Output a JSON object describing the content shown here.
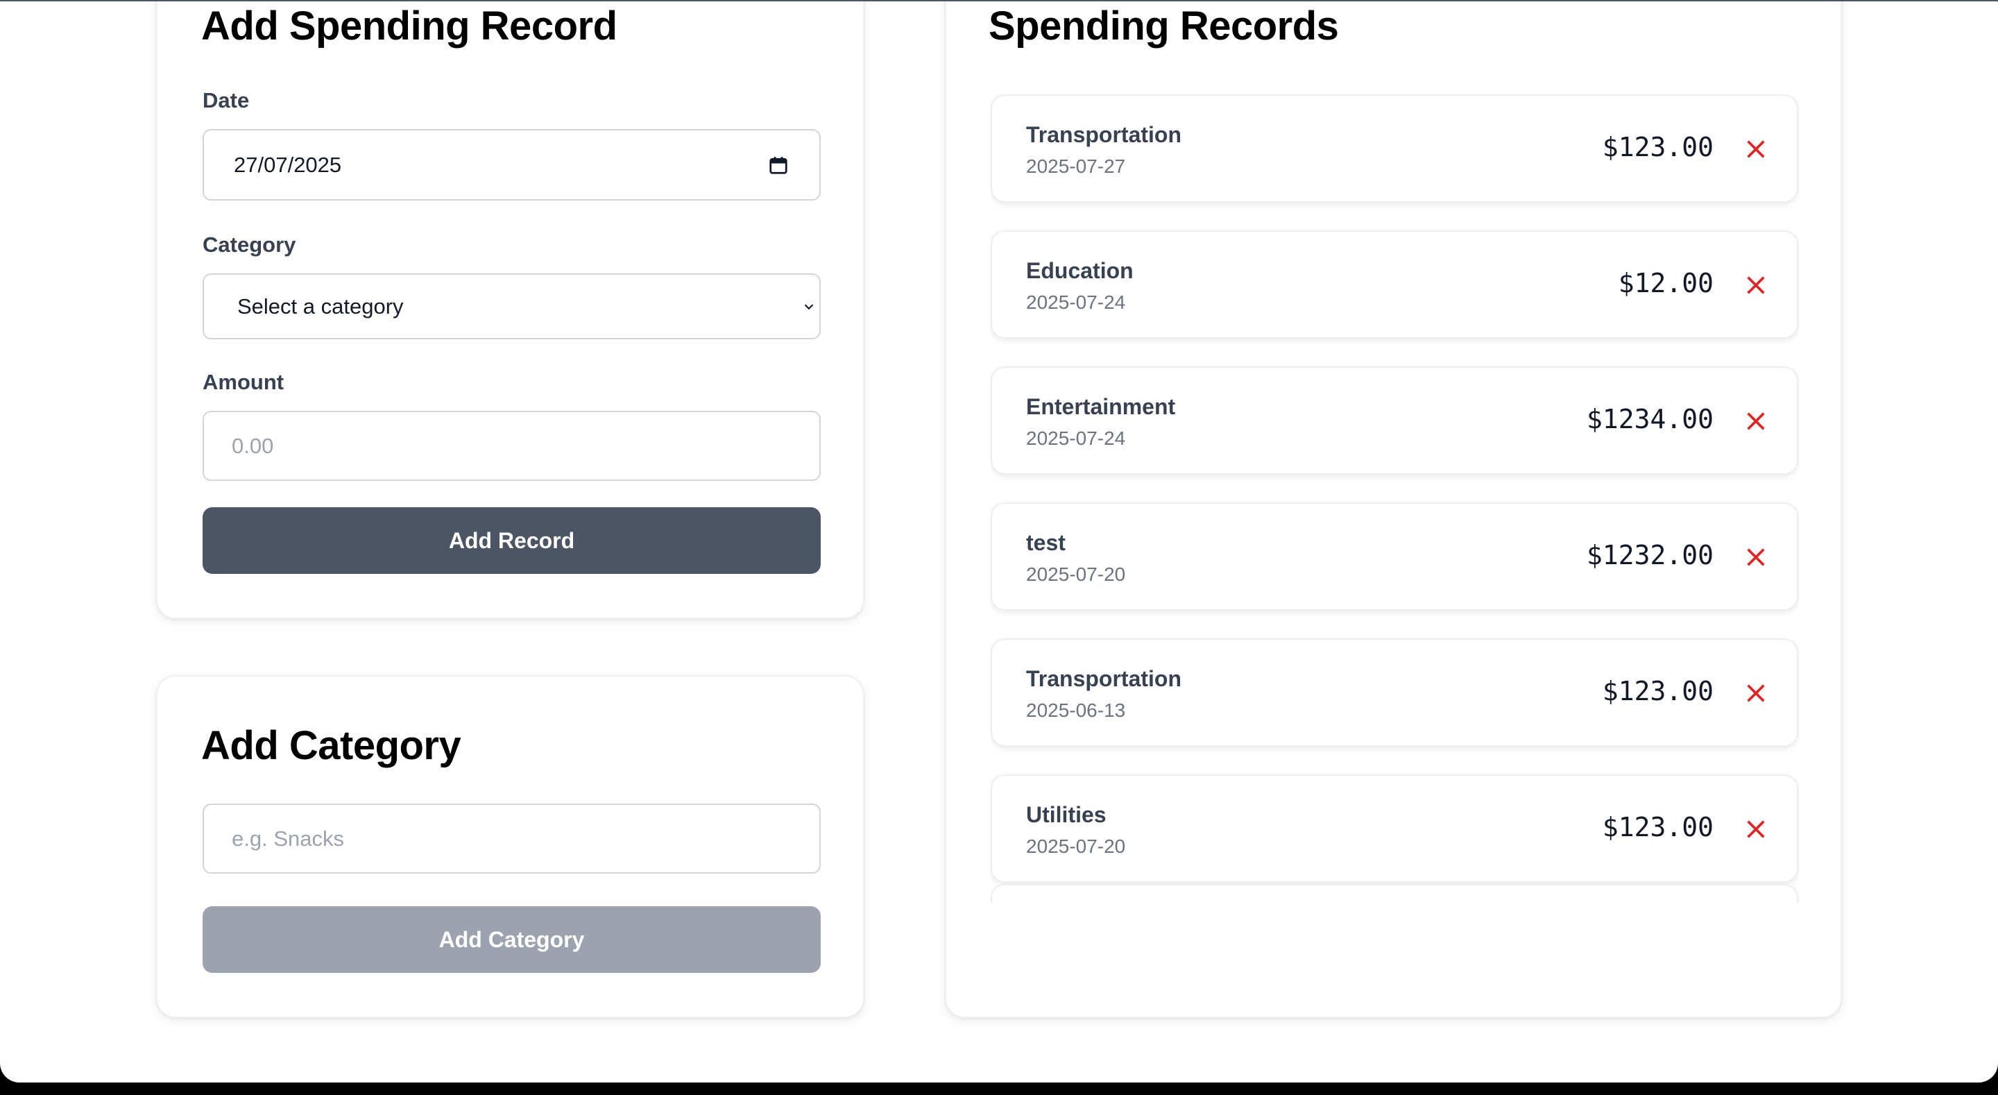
{
  "colors": {
    "primary_button": "#4b5563",
    "disabled_button": "#9ca3af",
    "delete_icon": "#dc2626",
    "text_label": "#374151",
    "text_muted": "#6b7280",
    "outer_background": "#000000"
  },
  "record_form": {
    "title": "Add Spending Record",
    "date_label": "Date",
    "date_value": "27/07/2025",
    "date_icon": "calendar-icon",
    "category_label": "Category",
    "category_selected": "Select a category",
    "amount_label": "Amount",
    "amount_placeholder": "0.00",
    "submit_label": "Add Record"
  },
  "category_form": {
    "title": "Add Category",
    "name_placeholder": "e.g. Snacks",
    "submit_label": "Add Category"
  },
  "records_panel": {
    "title": "Spending Records",
    "delete_icon": "close-icon",
    "records": [
      {
        "category": "Transportation",
        "date": "2025-07-27",
        "amount": "$123.00"
      },
      {
        "category": "Education",
        "date": "2025-07-24",
        "amount": "$12.00"
      },
      {
        "category": "Entertainment",
        "date": "2025-07-24",
        "amount": "$1234.00"
      },
      {
        "category": "test",
        "date": "2025-07-20",
        "amount": "$1232.00"
      },
      {
        "category": "Transportation",
        "date": "2025-06-13",
        "amount": "$123.00"
      },
      {
        "category": "Utilities",
        "date": "2025-07-20",
        "amount": "$123.00"
      },
      {
        "category": "",
        "date": "",
        "amount": ""
      }
    ]
  }
}
